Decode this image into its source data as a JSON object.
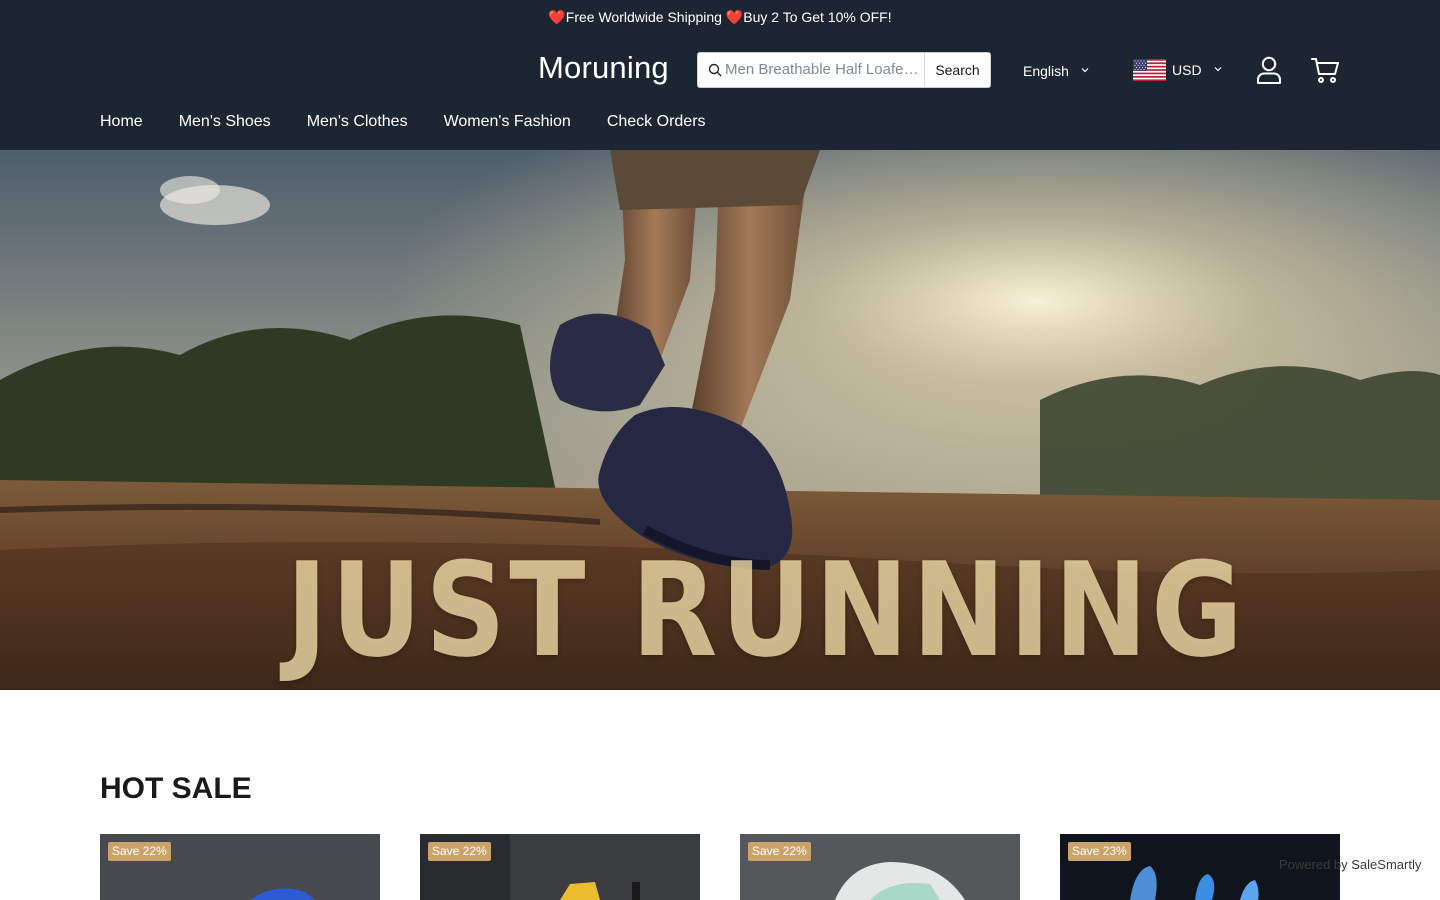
{
  "announcement": "❤️Free Worldwide Shipping ❤️Buy 2 To Get 10% OFF!",
  "header": {
    "logo": "Moruning",
    "search_placeholder": "Men Breathable Half Loafers Shoes",
    "search_button": "Search",
    "language": "English",
    "currency": "USD",
    "currency_flag": "us-flag-icon",
    "account_icon": "user-icon",
    "cart_icon": "cart-icon"
  },
  "nav": {
    "items": [
      {
        "label": "Home"
      },
      {
        "label": "Men's Shoes"
      },
      {
        "label": "Men's Clothes"
      },
      {
        "label": "Women's Fashion"
      },
      {
        "label": "Check Orders"
      }
    ]
  },
  "hero": {
    "headline": "JUST RUNNING"
  },
  "hot_sale": {
    "title": "HOT SALE",
    "products": [
      {
        "badge": "Save 22%"
      },
      {
        "badge": "Save 22%"
      },
      {
        "badge": "Save 22%"
      },
      {
        "badge": "Save 23%"
      }
    ]
  },
  "chat_widget": {
    "powered_by": "Powered by SaleSmartly"
  },
  "colors": {
    "header_bg": "#1c2632",
    "badge_bg": "#c9a36a"
  }
}
